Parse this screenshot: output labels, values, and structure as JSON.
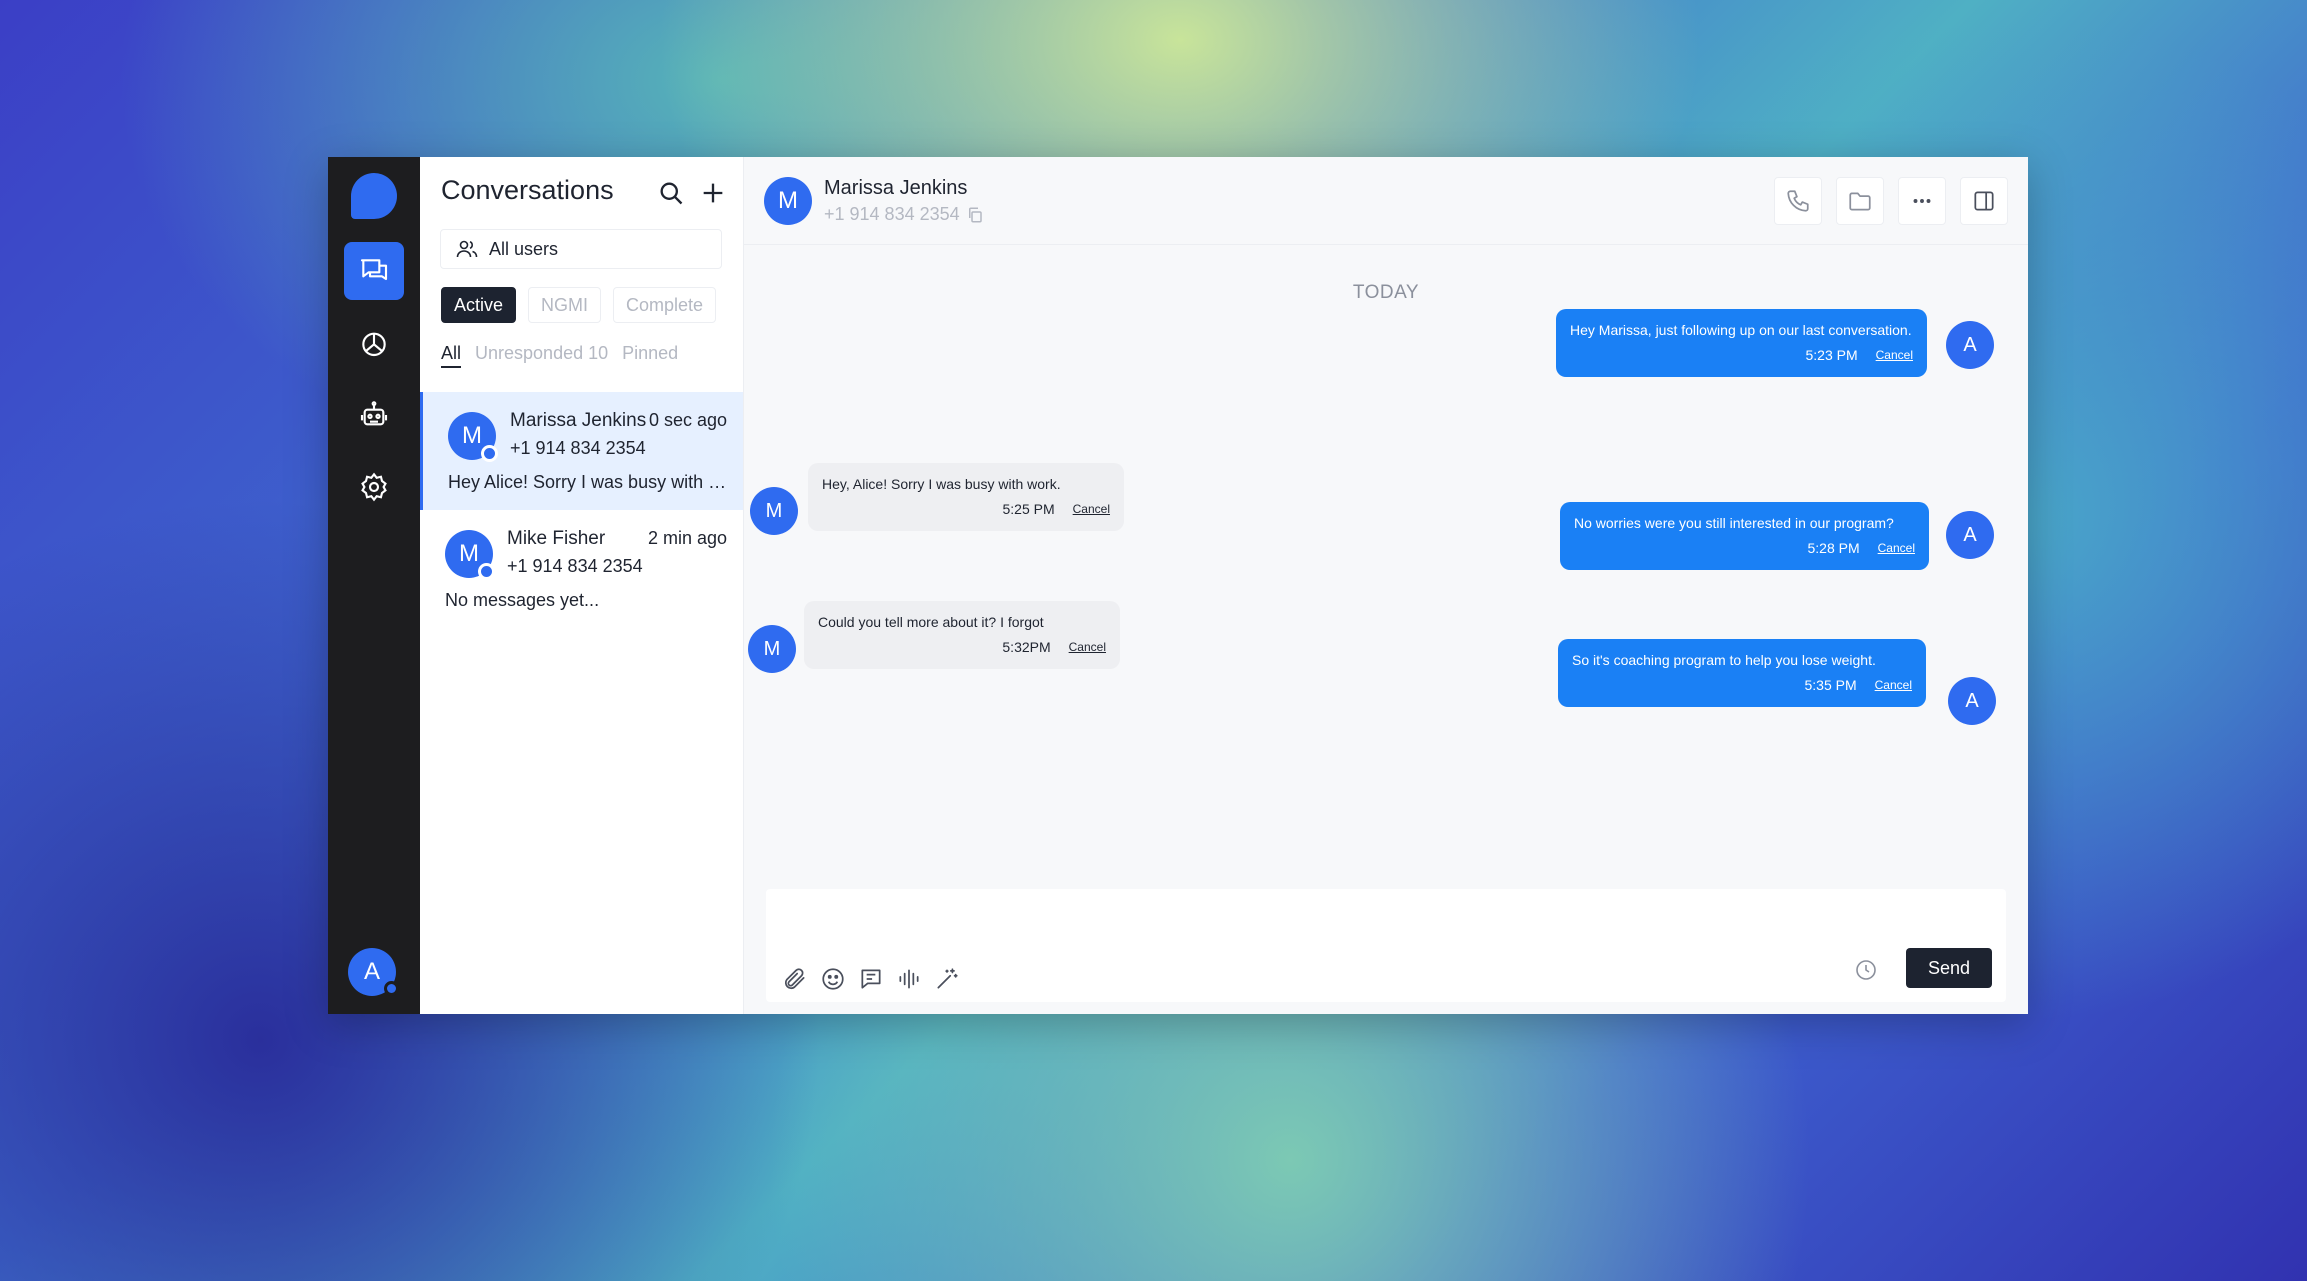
{
  "app": {
    "rail_items": [
      {
        "icon": "chat-bubbles-icon",
        "active": true
      },
      {
        "icon": "analytics-pie-icon",
        "active": false
      },
      {
        "icon": "robot-icon",
        "active": false
      },
      {
        "icon": "gear-icon",
        "active": false
      }
    ],
    "user_avatar": "A",
    "accent": "#2f6bf0"
  },
  "sidebar": {
    "title": "Conversations",
    "users_filter": "All users",
    "status_tabs": [
      "Active",
      "NGMI",
      "Complete"
    ],
    "filters": [
      "All",
      "Unresponded 10",
      "Pinned"
    ],
    "conversations": [
      {
        "avatar": "M",
        "name": "Marissa Jenkins",
        "time": "0 sec ago",
        "phone": "+1 914 834 2354",
        "preview": "Hey Alice! Sorry I was busy with work."
      },
      {
        "avatar": "M",
        "name": "Mike Fisher",
        "time": "2 min ago",
        "phone": "+1 914 834 2354",
        "preview": "No messages yet..."
      }
    ]
  },
  "chat": {
    "avatar": "M",
    "name": "Marissa Jenkins",
    "phone": "+1 914 834 2354",
    "date_divider": "TODAY",
    "messages": [
      {
        "text": "Hey Marissa, just following up on our last conversation.",
        "time": "5:23 PM",
        "action": "Cancel",
        "avatar": "A"
      },
      {
        "text": "Hey, Alice! Sorry I was busy with work.",
        "time": "5:25 PM",
        "action": "Cancel",
        "avatar": "M"
      },
      {
        "text": "No worries were you still interested in our program?",
        "time": "5:28 PM",
        "action": "Cancel",
        "avatar": "A"
      },
      {
        "text": "Could you tell more about it? I forgot",
        "time": "5:32PM",
        "action": "Cancel",
        "avatar": "M"
      },
      {
        "text": "So it's coaching program to help you lose weight.",
        "time": "5:35 PM",
        "action": "Cancel",
        "avatar": "A"
      }
    ],
    "composer": {
      "send_label": "Send"
    }
  }
}
